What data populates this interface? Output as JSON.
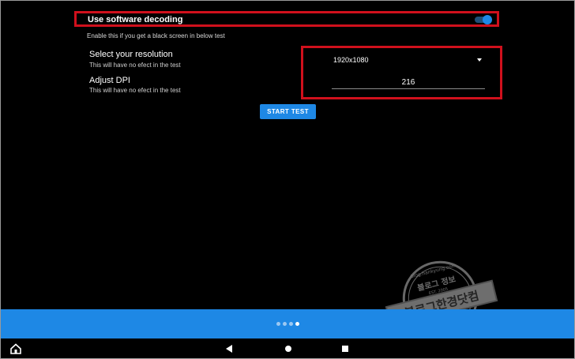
{
  "software_decoding": {
    "title": "Use software decoding",
    "description": "Enable this if you get a black screen in below test",
    "enabled": true
  },
  "resolution": {
    "title": "Select your resolution",
    "subtitle": "This will have no efect in the test",
    "selected": "1920x1080",
    "icon": "caret-down-icon"
  },
  "dpi": {
    "title": "Adjust DPI",
    "subtitle": "This will have no efect in the test",
    "value": "216"
  },
  "start_button": {
    "label": "START TEST"
  },
  "pager": {
    "total": 4,
    "active_index": 3
  },
  "navbar": {
    "icons": [
      "home-corner-icon",
      "back-icon",
      "home-icon",
      "recents-icon"
    ]
  },
  "watermark": {
    "lines": [
      "블로그 정보",
      "블로그한경닷컴",
      "blog.hankyung.com",
      "EST. 2005"
    ]
  },
  "colors": {
    "accent": "#1e88e5",
    "highlight_border": "#d0101c",
    "background": "#000000"
  }
}
